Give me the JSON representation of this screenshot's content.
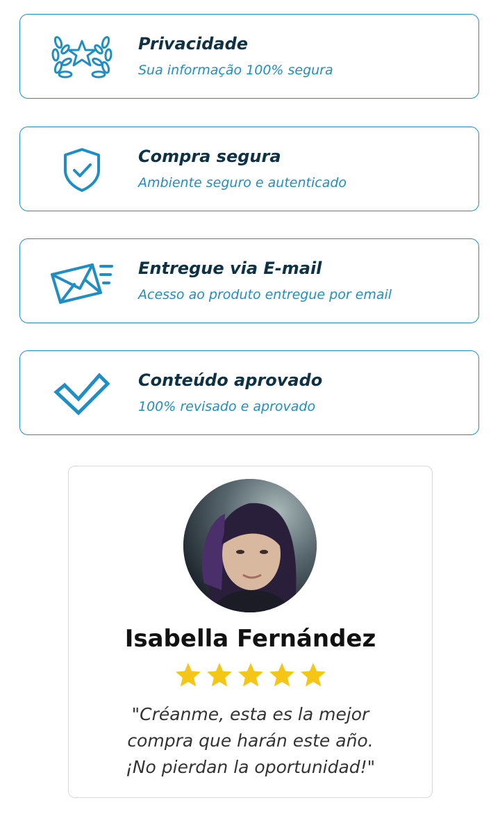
{
  "colors": {
    "accent": "#1f8ec4",
    "title": "#0d3145",
    "star": "#f5c518",
    "quote": "#333333"
  },
  "features": [
    {
      "icon": "laurel-star-icon",
      "title": "Privacidade",
      "subtitle": "Sua informação 100% segura"
    },
    {
      "icon": "shield-check-icon",
      "title": "Compra segura",
      "subtitle": "Ambiente seguro e autenticado"
    },
    {
      "icon": "email-icon",
      "title": "Entregue via E-mail",
      "subtitle": "Acesso ao produto entregue por email"
    },
    {
      "icon": "checkmark-icon",
      "title": "Conteúdo aprovado",
      "subtitle": "100% revisado e aprovado"
    }
  ],
  "testimonial": {
    "name": "Isabella Fernández",
    "rating": 5,
    "rating_max": 5,
    "quote_lines": [
      "\"Créanme, esta es la mejor",
      "compra que harán este año.",
      "¡No pierdan la oportunidad!\""
    ]
  }
}
